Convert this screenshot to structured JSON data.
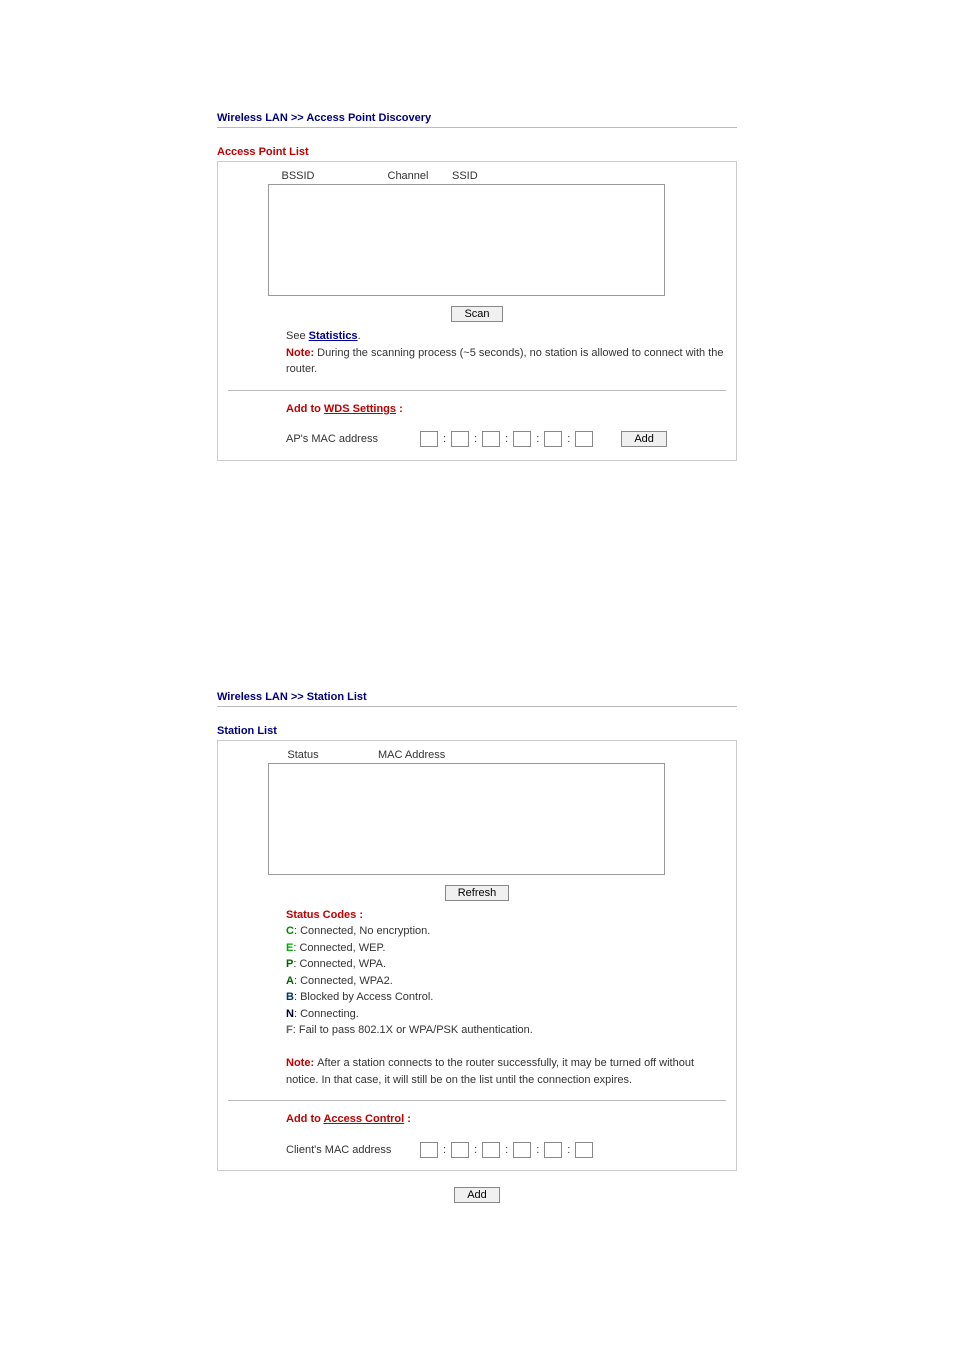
{
  "crumb1": "Wireless LAN >> Access Point Discovery",
  "apList": {
    "heading": "Access Point List",
    "col_bssid": "BSSID",
    "col_channel": "Channel",
    "col_ssid": "SSID",
    "scan_btn": "Scan",
    "see_prefix": "See ",
    "stats_link": "Statistics",
    "see_suffix": ".",
    "note_label": "Note: ",
    "note_text": "During the scanning process (~5 seconds), no station is allowed to connect with the router.",
    "addto_prefix": "Add to ",
    "wds_link": "WDS Settings",
    "addto_suffix": " :",
    "mac_label": "AP's MAC address",
    "add_btn": "Add"
  },
  "crumb2": "Wireless LAN >> Station List",
  "stList": {
    "heading": "Station List",
    "col_status": "Status",
    "col_mac": "MAC Address",
    "refresh_btn": "Refresh",
    "codes_title": "Status Codes :",
    "c_c": "C",
    "c_c_t": ": Connected, No encryption.",
    "c_e": "E",
    "c_e_t": ": Connected, WEP.",
    "c_p": "P",
    "c_p_t": ": Connected, WPA.",
    "c_a": "A",
    "c_a_t": ": Connected, WPA2.",
    "c_b": "B",
    "c_b_t": ": Blocked by Access Control.",
    "c_n": "N",
    "c_n_t": ": Connecting.",
    "c_f": "F",
    "c_f_t": ": Fail to pass 802.1X or WPA/PSK authentication.",
    "note_label": "Note: ",
    "note_text": "After a station connects to the router successfully, it may be turned off without notice. In that case, it will still be on the list until the connection expires.",
    "addto_prefix": "Add to ",
    "ac_link": "Access Control",
    "addto_suffix": " :",
    "mac_label": "Client's MAC address",
    "add_btn": "Add"
  }
}
